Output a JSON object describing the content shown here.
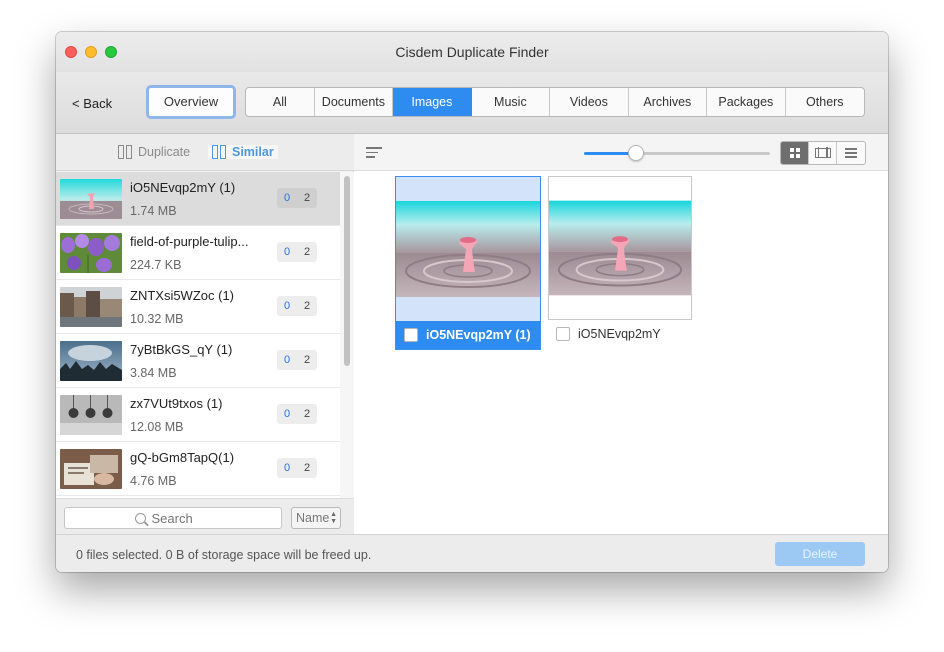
{
  "window": {
    "title": "Cisdem Duplicate Finder"
  },
  "toolbar": {
    "back_label": "< Back",
    "overview_label": "Overview",
    "tabs": [
      "All",
      "Documents",
      "Images",
      "Music",
      "Videos",
      "Archives",
      "Packages",
      "Others"
    ],
    "active_tab": "Images"
  },
  "left_panel": {
    "mode_duplicate": "Duplicate",
    "mode_similar": "Similar",
    "active_mode": "Similar",
    "items": [
      {
        "name": "iO5NEvqp2mY (1)",
        "size": "1.74 MB",
        "checked": "0",
        "count": "2",
        "selected": true,
        "thumb": "pink-drop"
      },
      {
        "name": "field-of-purple-tulip...",
        "size": "224.7 KB",
        "checked": "0",
        "count": "2",
        "selected": false,
        "thumb": "purple-tulips"
      },
      {
        "name": "ZNTXsi5WZoc (1)",
        "size": "10.32 MB",
        "checked": "0",
        "count": "2",
        "selected": false,
        "thumb": "canal-houses"
      },
      {
        "name": "7yBtBkGS_qY (1)",
        "size": "3.84 MB",
        "checked": "0",
        "count": "2",
        "selected": false,
        "thumb": "cloudy-forest"
      },
      {
        "name": "zx7VUt9txos (1)",
        "size": "12.08 MB",
        "checked": "0",
        "count": "2",
        "selected": false,
        "thumb": "gray-lamps"
      },
      {
        "name": "gQ-bGm8TapQ(1)",
        "size": "4.76 MB",
        "checked": "0",
        "count": "2",
        "selected": false,
        "thumb": "desk-work"
      }
    ],
    "search_placeholder": "Search",
    "sort_label": "Name"
  },
  "right_panel": {
    "thumbnail_size_fraction": 0.28,
    "view_modes": [
      "grid-view-icon",
      "filmstrip-view-icon",
      "list-view-icon"
    ],
    "active_view": "grid-view-icon",
    "cards": [
      {
        "label": "iO5NEvqp2mY (1)",
        "selected": true
      },
      {
        "label": "iO5NEvqp2mY",
        "selected": false
      }
    ]
  },
  "statusbar": {
    "text": "0 files selected. 0 B of storage space will be freed up.",
    "delete_label": "Delete"
  },
  "colors": {
    "accent": "#2e8cf0",
    "selected_row": "#dcdcdc",
    "delete_disabled": "#9cc8f4"
  }
}
